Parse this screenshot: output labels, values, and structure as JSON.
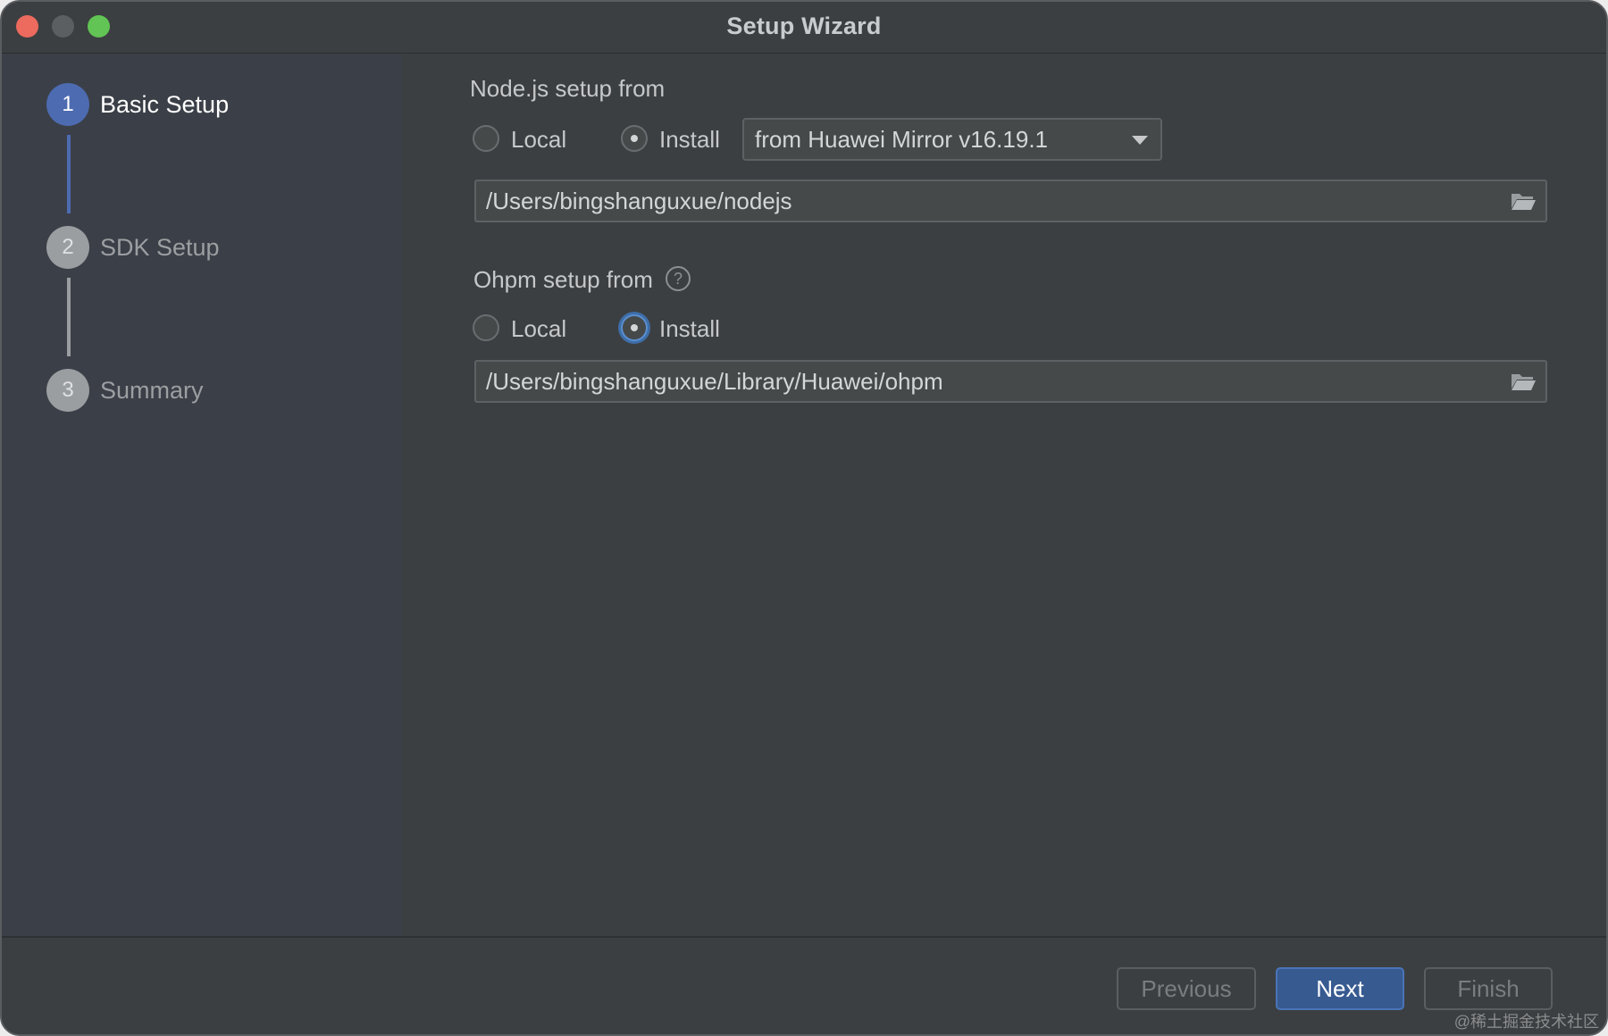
{
  "window": {
    "title": "Setup Wizard"
  },
  "steps": [
    {
      "number": "1",
      "label": "Basic Setup",
      "state": "active"
    },
    {
      "number": "2",
      "label": "SDK Setup",
      "state": "inactive"
    },
    {
      "number": "3",
      "label": "Summary",
      "state": "inactive"
    }
  ],
  "nodejs": {
    "label": "Node.js setup from",
    "option_local": "Local",
    "option_install": "Install",
    "selected": "Install",
    "source_select": "from Huawei Mirror v16.19.1",
    "path": "/Users/bingshanguxue/nodejs"
  },
  "ohpm": {
    "label": "Ohpm setup from",
    "help_icon": "?",
    "option_local": "Local",
    "option_install": "Install",
    "selected": "Install",
    "path": "/Users/bingshanguxue/Library/Huawei/ohpm"
  },
  "footer": {
    "previous": "Previous",
    "next": "Next",
    "finish": "Finish"
  },
  "watermark": "@稀土掘金技术社区",
  "colors": {
    "accent": "#4d6bb0",
    "background": "#3c3f41",
    "sidebar": "#3b3f47",
    "primary_button": "#375a91"
  }
}
